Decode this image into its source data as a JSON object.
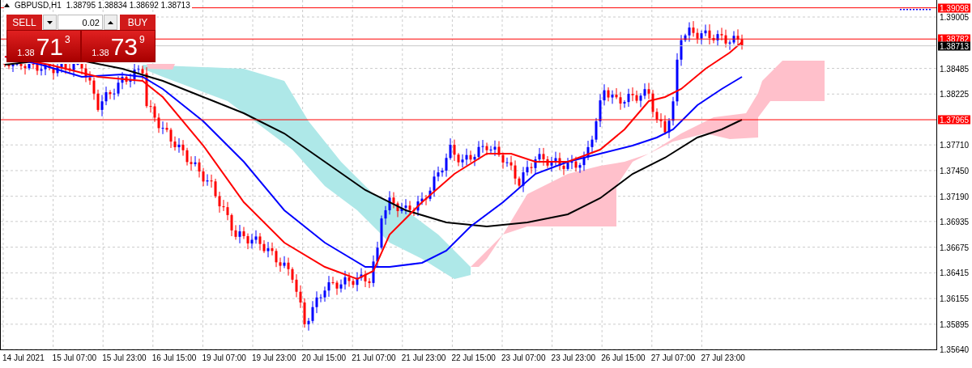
{
  "symbol_bar": {
    "title": "GBPUSD,H1",
    "ohlc": "1.38795 1.38834 1.38692 1.38713"
  },
  "trade_panel": {
    "volume": "0.02",
    "sides": [
      {
        "kind": "sell",
        "label": "SELL",
        "prefix": "1.38",
        "big": "71",
        "pip": "3"
      },
      {
        "kind": "buy",
        "label": "BUY",
        "prefix": "1.38",
        "big": "73",
        "pip": "9"
      }
    ]
  },
  "price_lines": [
    {
      "kind": "level",
      "label": "1.39098"
    },
    {
      "kind": "level",
      "label": "1.38782"
    },
    {
      "kind": "bid",
      "label": "1.38713"
    },
    {
      "kind": "level",
      "label": "1.37965"
    }
  ],
  "price_ticks": [
    "1.39005",
    "1.38485",
    "1.38225",
    "1.37710",
    "1.37450",
    "1.37190",
    "1.36935",
    "1.36675",
    "1.36415",
    "1.36155",
    "1.35895",
    "1.35640"
  ],
  "time_ticks": [
    "14 Jul 2021",
    "15 Jul 07:00",
    "15 Jul 23:00",
    "16 Jul 15:00",
    "19 Jul 07:00",
    "19 Jul 23:00",
    "20 Jul 15:00",
    "21 Jul 07:00",
    "21 Jul 23:00",
    "22 Jul 15:00",
    "23 Jul 07:00",
    "23 Jul 23:00",
    "26 Jul 15:00",
    "27 Jul 07:00",
    "27 Jul 23:00"
  ]
}
